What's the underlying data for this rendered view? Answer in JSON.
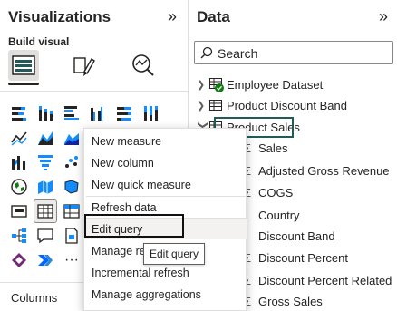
{
  "viz_pane": {
    "title": "Visualizations",
    "collapse_icon": "»",
    "build_label": "Build visual",
    "columns_label": "Columns"
  },
  "data_pane": {
    "title": "Data",
    "collapse_icon": "»",
    "search_placeholder": "Search",
    "tables": [
      {
        "name": "Employee Dataset",
        "expanded": false,
        "badge": "check"
      },
      {
        "name": "Product Discount Band",
        "expanded": false
      },
      {
        "name": "Product Sales",
        "expanded": true,
        "highlighted": true
      }
    ],
    "fields": [
      {
        "name": "Sales",
        "sigma": true
      },
      {
        "name": "Adjusted Gross Revenue",
        "sigma": true
      },
      {
        "name": "COGS",
        "sigma": true
      },
      {
        "name": "Country",
        "sigma": false
      },
      {
        "name": "Discount Band",
        "sigma": false
      },
      {
        "name": "Discount Percent",
        "sigma": true
      },
      {
        "name": "Discount Percent Related",
        "sigma": true
      },
      {
        "name": "Gross Sales",
        "sigma": true
      }
    ]
  },
  "context_menu": {
    "items": [
      {
        "label": "New measure"
      },
      {
        "label": "New column"
      },
      {
        "label": "New quick measure"
      },
      {
        "label": "Refresh data"
      },
      {
        "label": "Edit query",
        "hovered": true,
        "highlighted": true
      },
      {
        "label": "Manage re"
      },
      {
        "label": "Incremental refresh"
      },
      {
        "label": "Manage aggregations"
      }
    ]
  },
  "tooltip": {
    "text": "Edit query"
  },
  "colors": {
    "accent": "#205b5a",
    "yellow": "#f2c811",
    "blue": "#118dff",
    "dark_blue": "#12239e",
    "badge_green": "#107c10"
  }
}
